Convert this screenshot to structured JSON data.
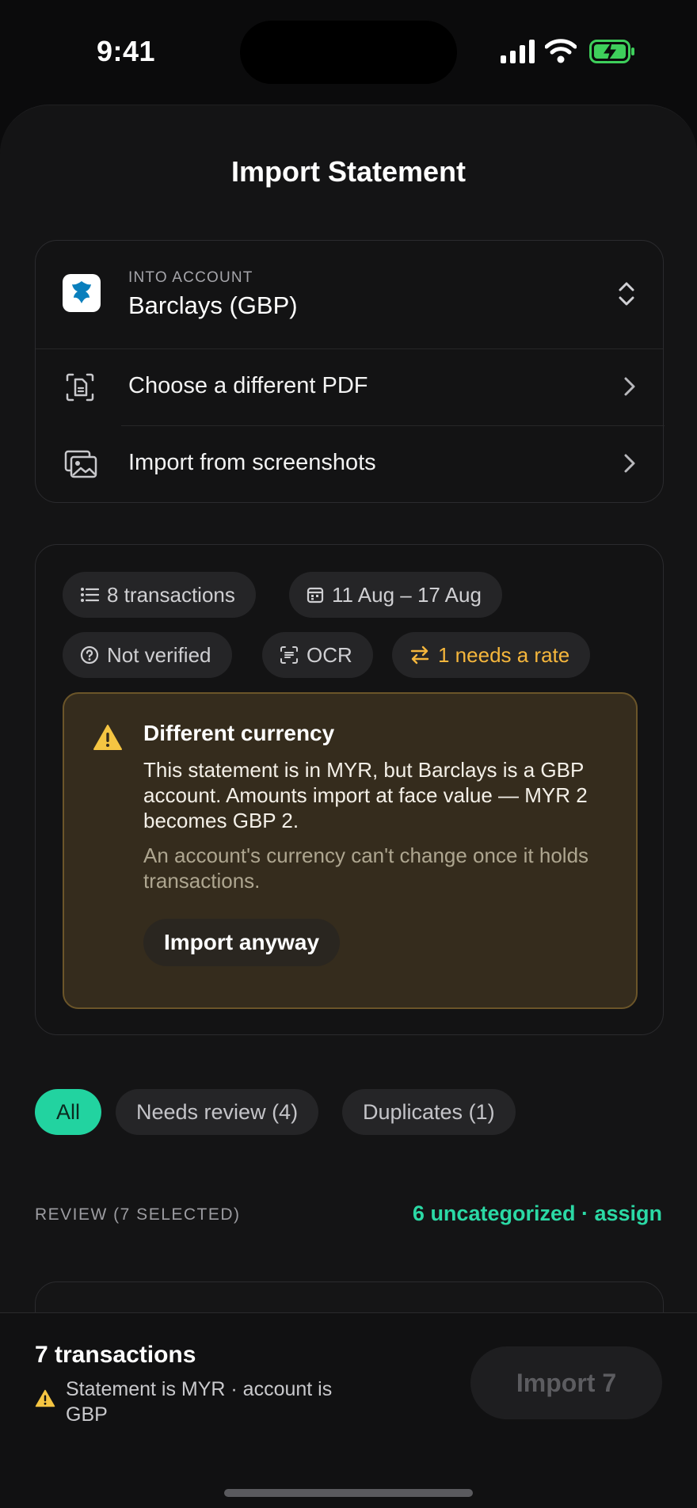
{
  "status_bar": {
    "time": "9:41"
  },
  "sheet": {
    "title": "Import Statement"
  },
  "account": {
    "caption": "INTO ACCOUNT",
    "name": "Barclays (GBP)",
    "options": [
      {
        "label": "Choose a different PDF",
        "icon": "pdf-scan-icon"
      },
      {
        "label": "Import from screenshots",
        "icon": "screenshots-icon"
      }
    ]
  },
  "summary": {
    "pills": {
      "transactions": "8 transactions",
      "dates": "11 Aug – 17 Aug",
      "verified": "Not verified",
      "ocr": "OCR",
      "rate": "1 needs a rate"
    },
    "alert": {
      "title": "Different currency",
      "body": "This statement is in MYR, but Barclays is a GBP account. Amounts import at face value — MYR 2 becomes GBP 2.",
      "note": "An account's currency can't change once it holds transactions.",
      "action": "Import anyway"
    }
  },
  "filters": {
    "all": "All",
    "needs_review": "Needs review (4)",
    "duplicates": "Duplicates (1)"
  },
  "review": {
    "header": "REVIEW (7 SELECTED)",
    "assign": "6 uncategorized · assign"
  },
  "bottom_bar": {
    "count": "7 transactions",
    "warning": "Statement is MYR · account is GBP",
    "import_button": "Import 7"
  },
  "colors": {
    "accent": "#22d3a0",
    "warning": "#f5b63c",
    "alert_bg": "#352c1d"
  }
}
